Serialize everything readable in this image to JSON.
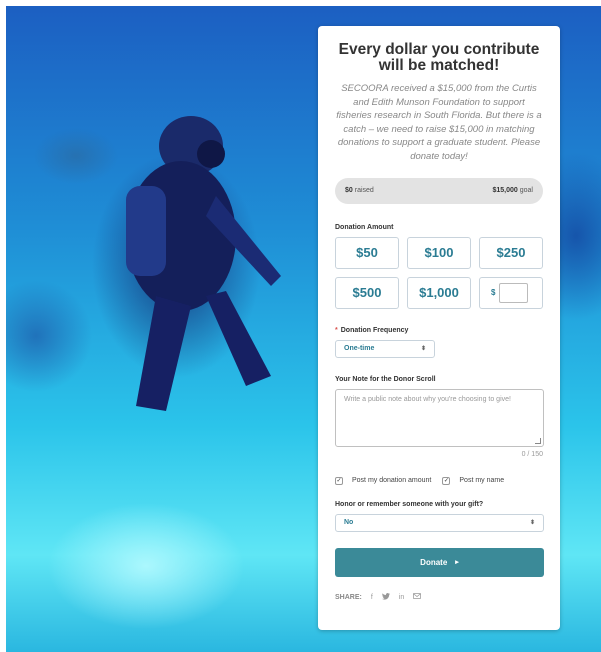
{
  "campaign": {
    "headline": "Every dollar you contribute will be matched!",
    "intro": "SECOORA received a $15,000 from the Curtis and Edith Munson Foundation to support fisheries research in South Florida. But there is a catch – we need to raise $15,000 in matching donations to support a graduate student. Please donate today!"
  },
  "progress": {
    "raised_amount": "$0",
    "raised_label": " raised",
    "goal_amount": "$15,000",
    "goal_label": " goal",
    "fraction": 0
  },
  "donation_amount": {
    "label": "Donation Amount",
    "options": [
      "$50",
      "$100",
      "$250",
      "$500",
      "$1,000"
    ],
    "currency_symbol": "$"
  },
  "frequency": {
    "required_marker": "*",
    "label": "Donation Frequency",
    "selected": "One-time"
  },
  "note": {
    "label": "Your Note for the Donor Scroll",
    "placeholder": "Write a public note about why you're choosing to give!",
    "counter": "0 / 150"
  },
  "options": {
    "post_amount": "Post my donation amount",
    "post_name": "Post my name"
  },
  "honor": {
    "label": "Honor or remember someone with your gift?",
    "selected": "No"
  },
  "donate": {
    "label": "Donate",
    "arrow": "▸"
  },
  "share": {
    "label": "SHARE:",
    "icons": [
      "facebook-icon",
      "twitter-icon",
      "linkedin-icon",
      "email-icon"
    ]
  },
  "colors": {
    "accent": "#3b8a98",
    "amount_text": "#2b7c93",
    "required": "#d9534f"
  }
}
